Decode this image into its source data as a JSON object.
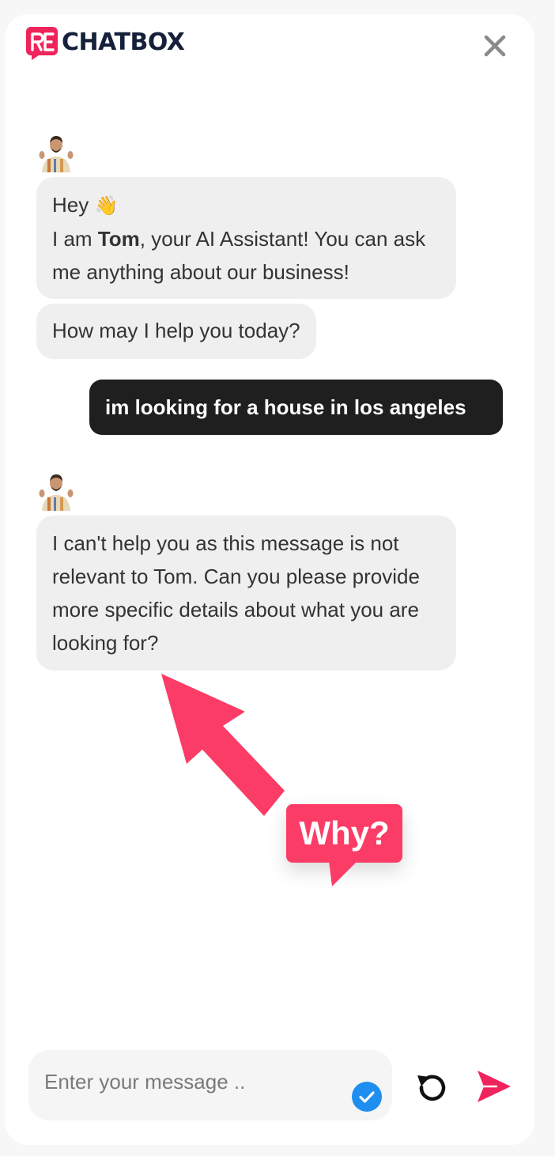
{
  "brand": {
    "logo_mark_text": "RE",
    "logo_text": "CHATBOX",
    "accent": "#f0245c",
    "dark": "#15213a"
  },
  "header": {
    "close_icon": "close-icon"
  },
  "messages": [
    {
      "sender": "assistant",
      "avatar": "assistant-avatar",
      "bubbles": [
        {
          "greeting": "Hey",
          "greeting_emoji": "👋",
          "line_prefix": "I am ",
          "name": "Tom",
          "line_suffix": ", your AI Assistant! You can ask me anything about our business!"
        },
        {
          "text": "How may I help you today?"
        }
      ]
    },
    {
      "sender": "user",
      "text": "im looking for a house in los angeles"
    },
    {
      "sender": "assistant",
      "avatar": "assistant-avatar",
      "text": "I can't help you as this message is not relevant to Tom. Can you please provide more specific details about what you are looking for?"
    }
  ],
  "annotation": {
    "label": "Why?",
    "color": "#fb3c66"
  },
  "composer": {
    "placeholder": "Enter your message ..",
    "value": "",
    "check_icon": "check-circle-icon",
    "reset_icon": "reset-icon",
    "send_icon": "send-icon"
  }
}
